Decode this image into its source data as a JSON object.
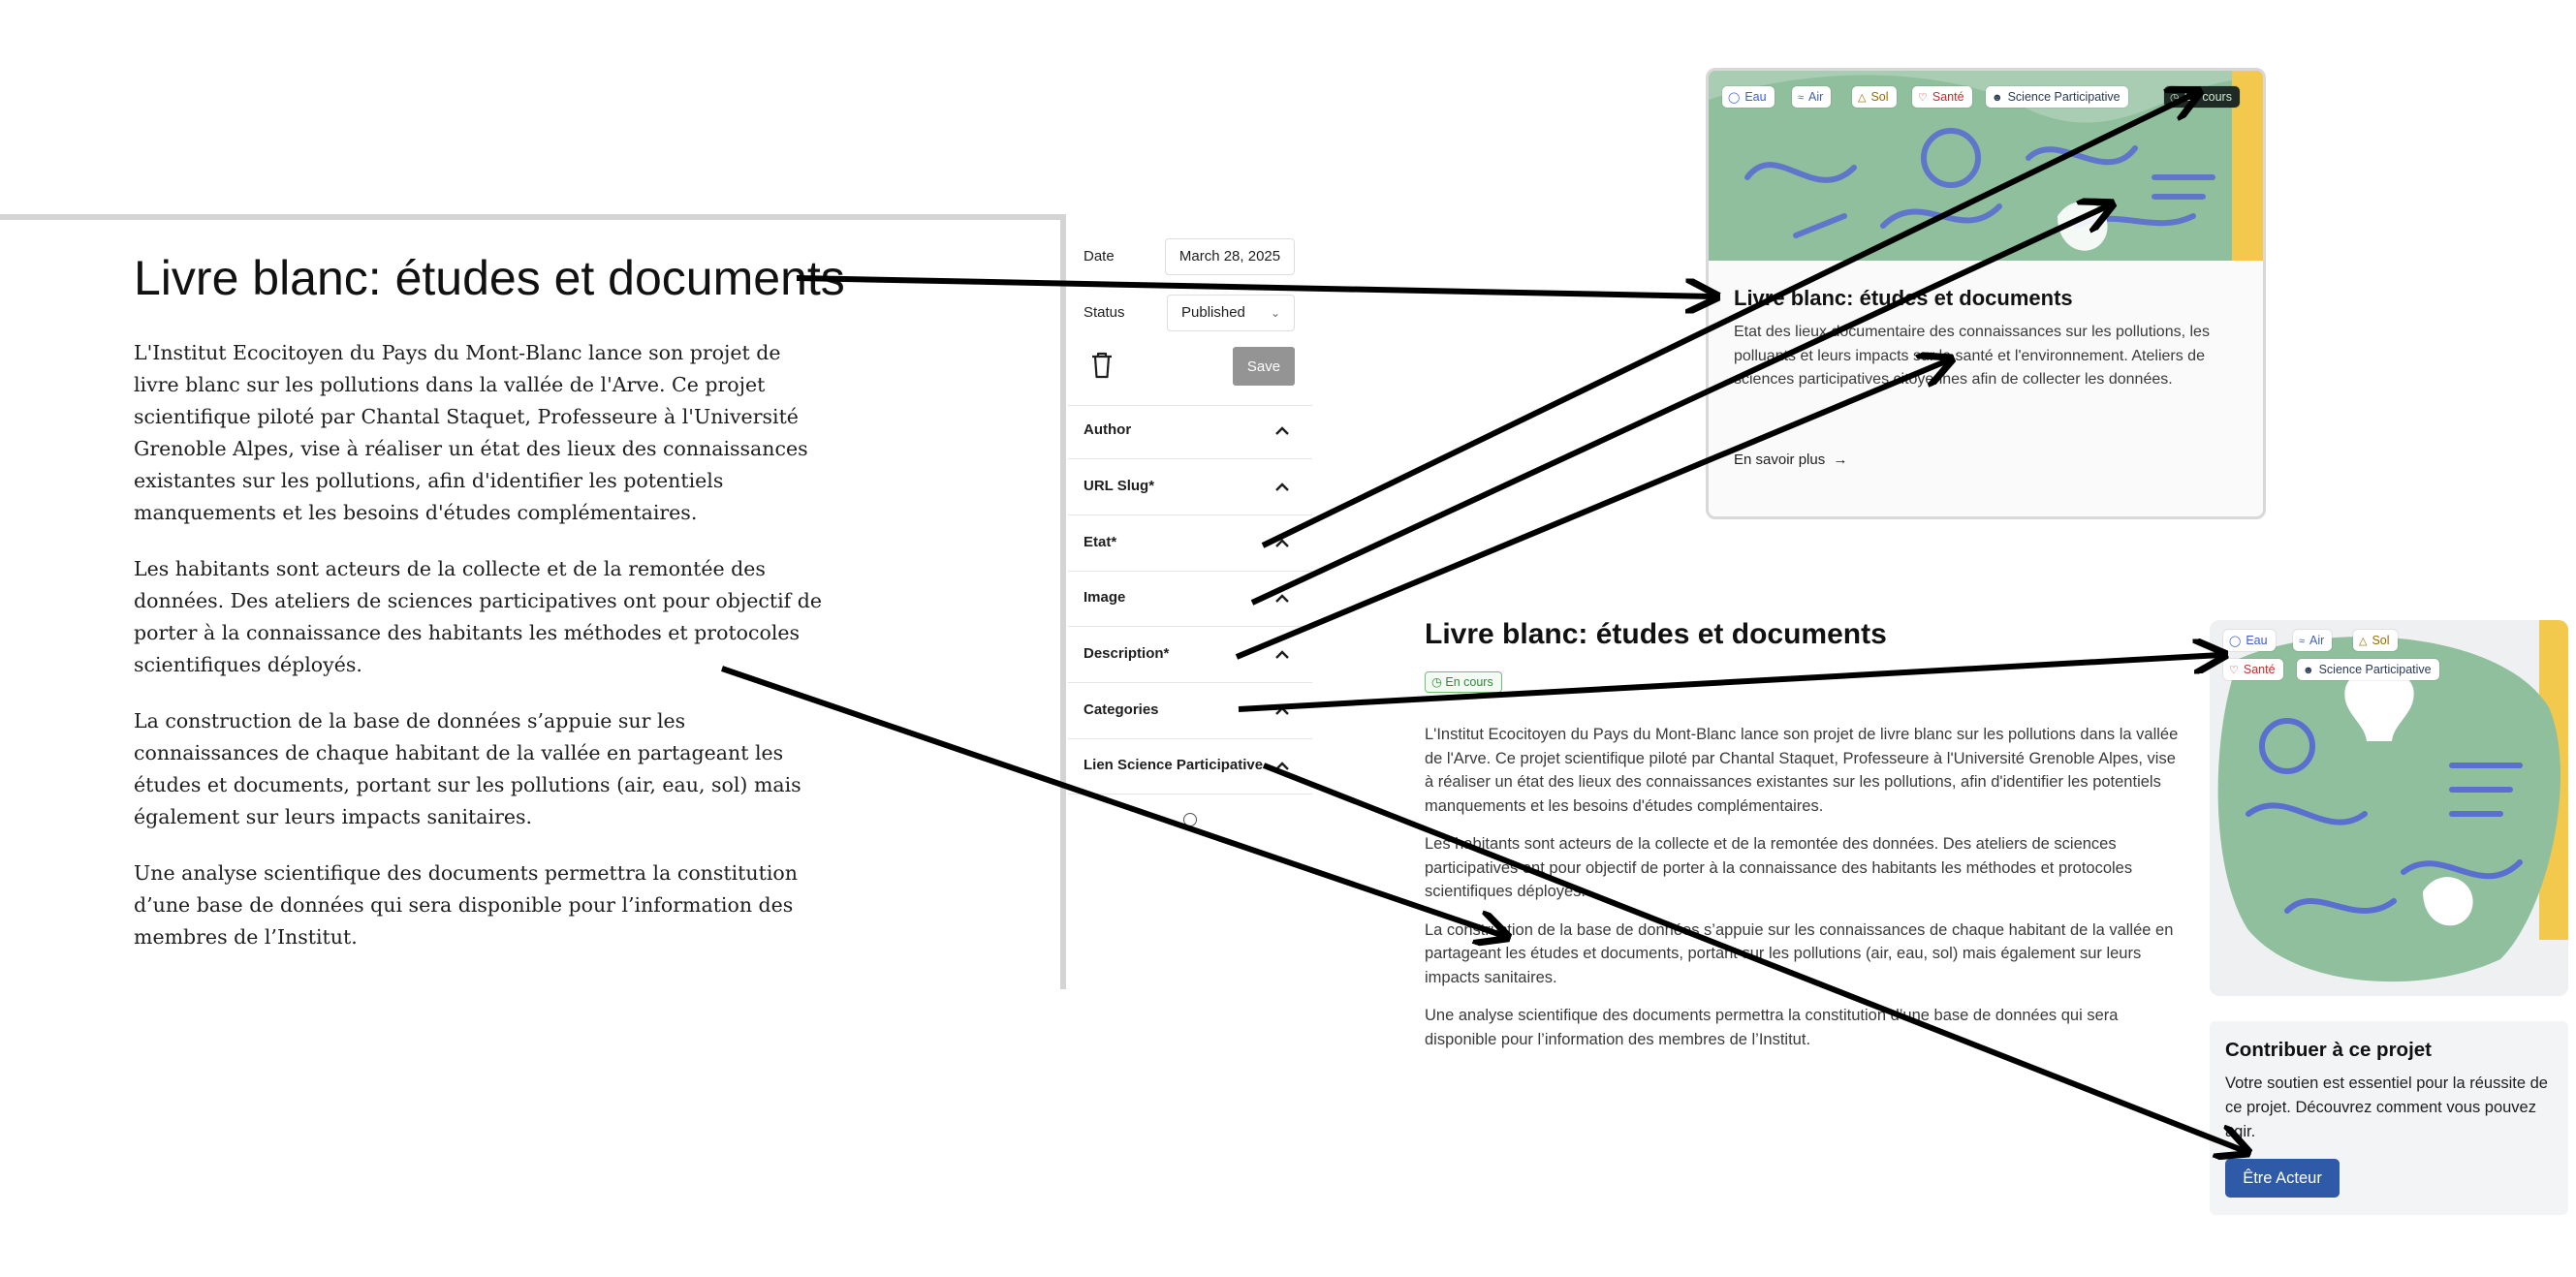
{
  "editor": {
    "title": "Livre blanc: études et documents",
    "paragraphs": [
      "L'Institut Ecocitoyen du Pays du Mont-Blanc lance son projet de livre blanc sur les pollutions dans la vallée de l'Arve. Ce projet scientifique piloté par Chantal Staquet, Professeure à l'Université Grenoble Alpes, vise à réaliser un état des lieux des connaissances existantes sur les pollutions, afin d'identifier les potentiels manquements et les besoins d'études complémentaires.",
      "Les habitants sont acteurs de la collecte et de la remontée des données. Des ateliers de sciences participatives ont pour objectif de porter à la connaissance des habitants les méthodes et protocoles scientifiques déployés.",
      "La construction de la base de données s’appuie sur les connaissances de chaque habitant de la vallée en partageant les études et documents, portant sur les pollutions (air, eau, sol) mais également sur leurs impacts sanitaires.",
      "Une analyse scientifique des documents permettra la constitution d’une base de données qui sera disponible pour l’information des membres de l’Institut."
    ]
  },
  "sidebar": {
    "date_label": "Date",
    "date_value": "March 28, 2025",
    "status_label": "Status",
    "status_value": "Published",
    "save_label": "Save",
    "sections": [
      "Author",
      "URL Slug*",
      "Etat*",
      "Image",
      "Description*",
      "Categories",
      "Lien Science Participative"
    ]
  },
  "card": {
    "tags": [
      "Eau",
      "Air",
      "Sol",
      "Santé",
      "Science Participative"
    ],
    "status": "En cours",
    "title": "Livre blanc: études et documents",
    "description": "Etat des lieux documentaire des connaissances sur les pollutions, les polluants et leurs impacts sur la santé et l'environnement. Ateliers de sciences participatives citoyennes afin de collecter les données.",
    "link": "En savoir plus"
  },
  "project_page": {
    "title": "Livre blanc: études et documents",
    "status": "En cours",
    "tags": [
      "Eau",
      "Air",
      "Sol",
      "Santé",
      "Science Participative"
    ],
    "paragraphs": [
      "L'Institut Ecocitoyen du Pays du Mont-Blanc lance son projet de livre blanc sur les pollutions dans la vallée de l'Arve. Ce projet scientifique piloté par Chantal Staquet, Professeure à l'Université Grenoble Alpes, vise à réaliser un état des lieux des connaissances existantes sur les pollutions, afin d'identifier les potentiels manquements et les besoins d'études complémentaires.",
      "Les habitants sont acteurs de la collecte et de la remontée des données. Des ateliers de sciences participatives ont pour objectif de porter à la connaissance des habitants les méthodes et protocoles scientifiques déployés.",
      "La construction de la base de données s’appuie sur les connaissances de chaque habitant de la vallée en partageant les études et documents, portant sur les pollutions (air, eau, sol) mais également sur leurs impacts sanitaires.",
      "Une analyse scientifique des documents permettra la constitution d’une base de données qui sera disponible pour l’information des membres de l’Institut."
    ],
    "contribute": {
      "title": "Contribuer à ce projet",
      "text": "Votre soutien est essentiel pour la réussite de ce projet. Découvrez comment vous pouvez agir.",
      "button": "Être Acteur"
    }
  },
  "colors": {
    "tag_eau": "#3b5bdb",
    "tag_air": "#4263a8",
    "tag_sol": "#9a6b00",
    "tag_sante": "#c92a2a",
    "tag_science": "#2b3a55",
    "status_dark_bg": "#1f2a24",
    "status_green": "#2f8a34",
    "button_blue": "#2e5aa7",
    "save_gray": "#949494",
    "illustration_green": "#8fbf9c",
    "illustration_blue": "#5a6fd0"
  }
}
